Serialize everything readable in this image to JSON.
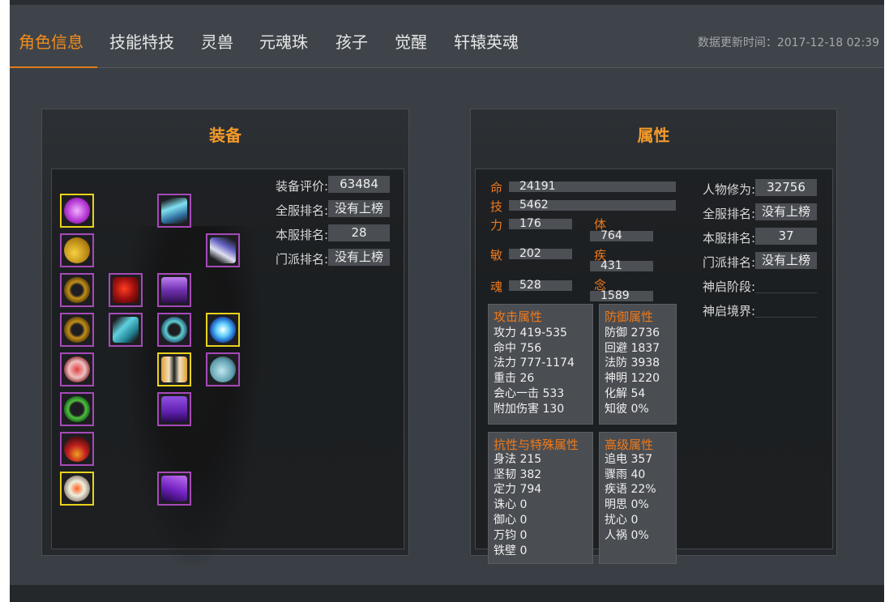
{
  "tabs": [
    "角色信息",
    "技能特技",
    "灵兽",
    "元魂珠",
    "孩子",
    "觉醒",
    "轩辕英魂"
  ],
  "update_time": "数据更新时间：2017-12-18 02:39",
  "equipment": {
    "title": "装备",
    "rating_label": "装备评价:",
    "rating_value": "63484",
    "server_all_label": "全服排名:",
    "server_all_value": "没有上榜",
    "server_local_label": "本服排名:",
    "server_local_value": "28",
    "sect_label": "门派排名:",
    "sect_value": "没有上榜"
  },
  "attributes": {
    "title": "属性",
    "ming_label": "命",
    "ming_value": "24191",
    "ji_label": "技",
    "ji_value": "5462",
    "li_label": "力",
    "li_value": "176",
    "ti_label": "体",
    "ti_value": "764",
    "min_label": "敏",
    "min_value": "202",
    "jiji_label": "疾",
    "jiji_value": "431",
    "hun_label": "魂",
    "hun_value": "528",
    "nian_label": "念",
    "nian_value": "1589",
    "cultivation_label": "人物修为:",
    "cultivation_value": "32756",
    "server_all_label": "全服排名:",
    "server_all_value": "没有上榜",
    "server_local_label": "本服排名:",
    "server_local_value": "37",
    "sect_label": "门派排名:",
    "sect_value": "没有上榜",
    "stage_label": "神启阶段:",
    "realm_label": "神启境界:"
  },
  "attack": {
    "title": "攻击属性",
    "lines": [
      "攻力 419-535",
      "命中 756",
      "法力 777-1174",
      "重击 26",
      "会心一击 533",
      "附加伤害 130"
    ]
  },
  "defense": {
    "title": "防御属性",
    "lines": [
      "防御 2736",
      "回避 1837",
      "法防 3938",
      "神明 1220",
      "化解 54",
      "知彼 0%"
    ]
  },
  "resist": {
    "title": "抗性与特殊属性",
    "lines": [
      "身法 215",
      "坚韧 382",
      "定力 794",
      "诛心 0",
      "御心 0",
      "万钧 0",
      "铁壁 0"
    ]
  },
  "advanced": {
    "title": "高级属性",
    "lines": [
      "追电 357",
      "骤雨 40",
      "疾语 22%",
      "明思 0%",
      "扰心 0",
      "人祸 0%"
    ]
  },
  "colors": {
    "accent": "#f28c1c",
    "purple_frame": "#a64ab8",
    "gold_frame": "#e8d21c"
  }
}
